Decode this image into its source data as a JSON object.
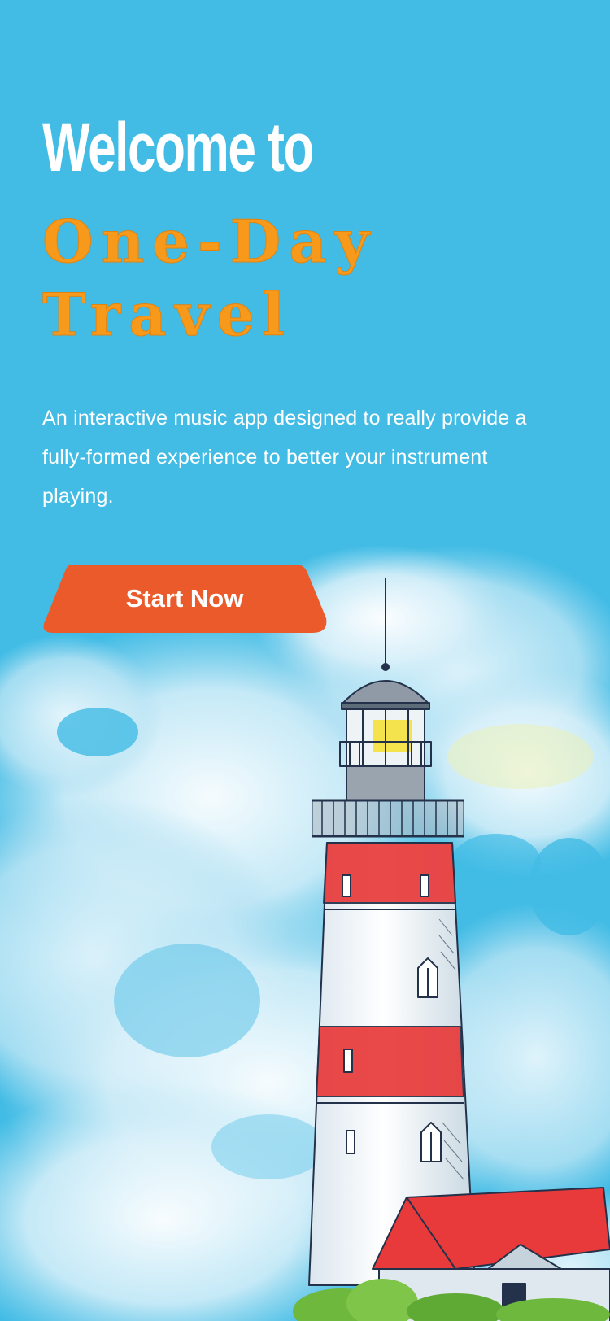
{
  "hero": {
    "welcome_text": "Welcome to",
    "brand_line1": "One-Day",
    "brand_line2": "Travel",
    "description": "An interactive music app designed to really provide a fully-formed experience to better your instrument playing."
  },
  "cta": {
    "start_label": "Start Now"
  },
  "illustration": {
    "name": "lighthouse-watercolor-illustration"
  },
  "colors": {
    "background": "#42bce5",
    "welcome_text": "#ffffff",
    "brand_text": "#f79a1c",
    "button": "#ea5a2b",
    "lighthouse_red": "#e83a3a",
    "lighthouse_light": "#f4e13a"
  }
}
